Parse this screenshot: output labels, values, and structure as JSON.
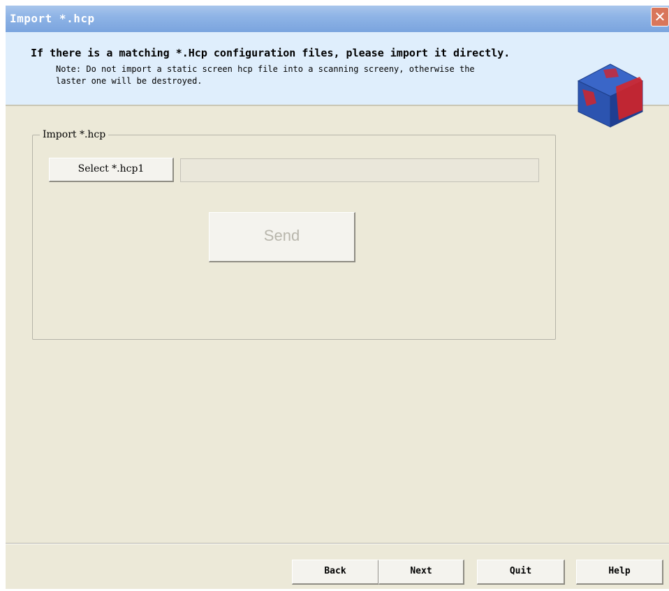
{
  "window": {
    "title": "Import *.hcp",
    "close_symbol": "✕"
  },
  "banner": {
    "heading": "If there is a matching *.Hcp configuration files, please import it directly.",
    "note_line1": "Note: Do not import a static screen hcp file into a scanning screeny, otherwise the",
    "note_line2": "laster one will be destroyed.",
    "logo_icon": "cube-logo-icon"
  },
  "import_group": {
    "legend": "Import *.hcp",
    "select_button": "Select *.hcp1",
    "path_value": "",
    "send_button": "Send"
  },
  "footer": {
    "back": "Back",
    "next": "Next",
    "quit": "Quit",
    "help": "Help"
  },
  "colors": {
    "titlebar": "#8fb4e6",
    "banner_bg": "#dfeefc",
    "dialog_bg": "#ece9d8",
    "close_button": "#d9765a"
  }
}
